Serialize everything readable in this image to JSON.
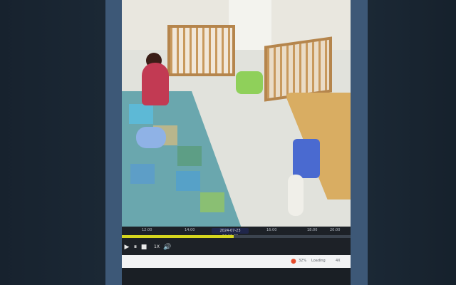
{
  "player": {
    "timeline_labels": [
      "12:00",
      "14:00",
      "",
      "16:00",
      "18:00",
      "20:00"
    ],
    "timestamp": "2024-07-23 12:10:30",
    "progress_percent": 49,
    "controls": {
      "play_icon": "▶",
      "pause_icon": "⏸",
      "stop_icon": "■",
      "stop_icon2": "◼",
      "speed": "1X",
      "volume_icon": "🔊"
    },
    "status": {
      "percent": "32%",
      "label": "Loading",
      "extra": "4X"
    }
  },
  "colors": {
    "bezel": "#3d5877",
    "progress": "#d6d61e",
    "badge": "#20264a"
  }
}
